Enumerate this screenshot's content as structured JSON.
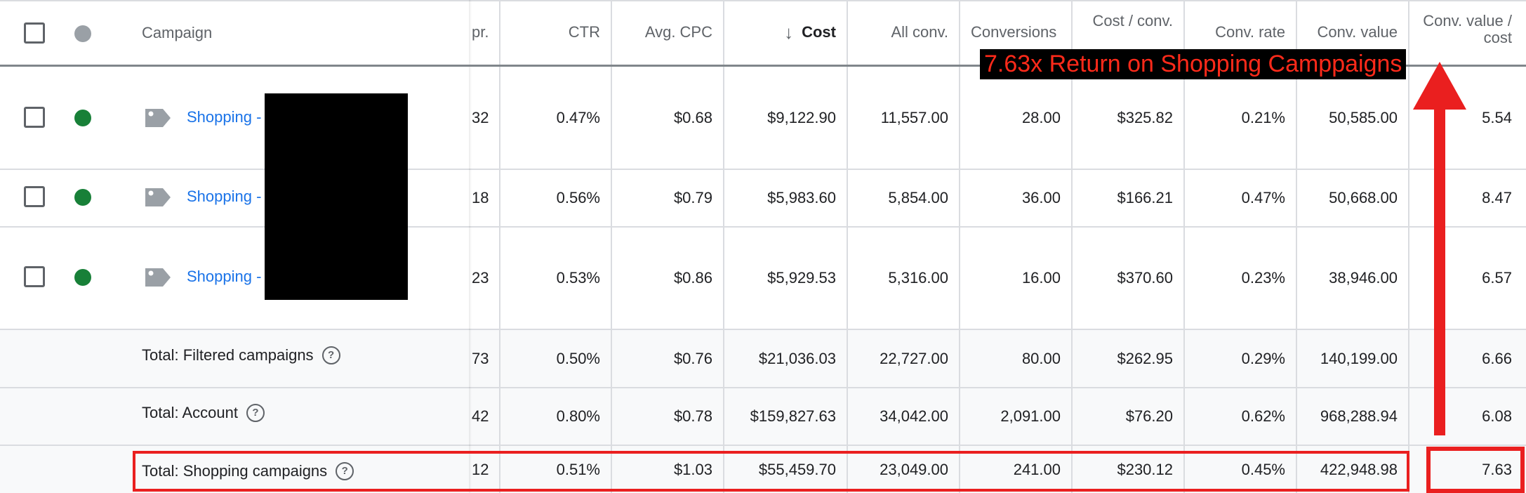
{
  "header": {
    "campaign": "Campaign",
    "impr_partial": "pr.",
    "ctr": "CTR",
    "avg_cpc": "Avg. CPC",
    "cost": "Cost",
    "all_conv": "All conv.",
    "conversions": "Conversions",
    "cost_per_conv": "Cost / conv.",
    "conv_rate": "Conv. rate",
    "conv_value": "Conv. value",
    "conv_value_per_cost": "Conv. value / cost",
    "sort_indicator": "↓"
  },
  "campaign_rows": [
    {
      "name": "Shopping -",
      "status": "enabled",
      "impr": "32",
      "ctr": "0.47%",
      "avg_cpc": "$0.68",
      "cost": "$9,122.90",
      "all_conv": "11,557.00",
      "conversions": "28.00",
      "cost_per_conv": "$325.82",
      "conv_rate": "0.21%",
      "conv_value": "50,585.00",
      "conv_value_per_cost": "5.54"
    },
    {
      "name": "Shopping -",
      "status": "enabled",
      "impr": "18",
      "ctr": "0.56%",
      "avg_cpc": "$0.79",
      "cost": "$5,983.60",
      "all_conv": "5,854.00",
      "conversions": "36.00",
      "cost_per_conv": "$166.21",
      "conv_rate": "0.47%",
      "conv_value": "50,668.00",
      "conv_value_per_cost": "8.47"
    },
    {
      "name": "Shopping -",
      "status": "enabled",
      "impr": "23",
      "ctr": "0.53%",
      "avg_cpc": "$0.86",
      "cost": "$5,929.53",
      "all_conv": "5,316.00",
      "conversions": "16.00",
      "cost_per_conv": "$370.60",
      "conv_rate": "0.23%",
      "conv_value": "38,946.00",
      "conv_value_per_cost": "6.57"
    }
  ],
  "total_rows": [
    {
      "label": "Total: Filtered campaigns",
      "impr": "73",
      "ctr": "0.50%",
      "avg_cpc": "$0.76",
      "cost": "$21,036.03",
      "all_conv": "22,727.00",
      "conversions": "80.00",
      "cost_per_conv": "$262.95",
      "conv_rate": "0.29%",
      "conv_value": "140,199.00",
      "conv_value_per_cost": "6.66"
    },
    {
      "label": "Total: Account",
      "impr": "42",
      "ctr": "0.80%",
      "avg_cpc": "$0.78",
      "cost": "$159,827.63",
      "all_conv": "34,042.00",
      "conversions": "2,091.00",
      "cost_per_conv": "$76.20",
      "conv_rate": "0.62%",
      "conv_value": "968,288.94",
      "conv_value_per_cost": "6.08"
    },
    {
      "label": "Total: Shopping campaigns",
      "impr": "12",
      "ctr": "0.51%",
      "avg_cpc": "$1.03",
      "cost": "$55,459.70",
      "all_conv": "23,049.00",
      "conversions": "241.00",
      "cost_per_conv": "$230.12",
      "conv_rate": "0.45%",
      "conv_value": "422,948.98",
      "conv_value_per_cost": "7.63"
    }
  ],
  "annotation": {
    "callout": "7.63x Return on Shopping Camppaigns",
    "color": "#ea1f1f"
  },
  "colors": {
    "link": "#1a73e8",
    "enabled_dot": "#188038",
    "header_dot": "#9aa0a6"
  }
}
